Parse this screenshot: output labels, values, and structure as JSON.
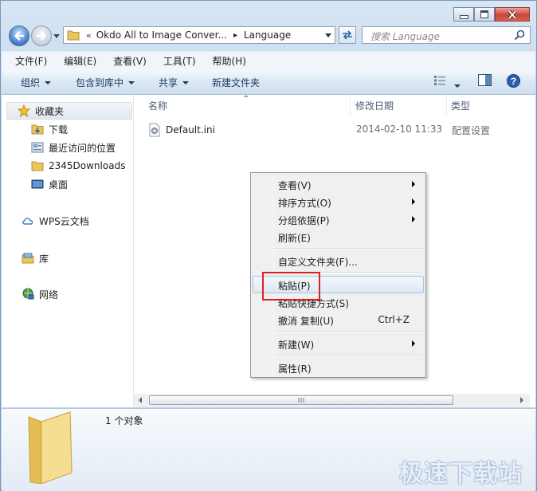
{
  "address": {
    "chevron": "«",
    "segments": [
      "Okdo All to Image Conver...",
      "Language"
    ],
    "separator": "▸"
  },
  "search": {
    "placeholder": "搜索 Language"
  },
  "menubar": [
    "文件(F)",
    "编辑(E)",
    "查看(V)",
    "工具(T)",
    "帮助(H)"
  ],
  "commandbar": {
    "organize": "组织",
    "include_library": "包含到库中",
    "share": "共享",
    "new_folder": "新建文件夹"
  },
  "navpane": {
    "favorites": "收藏夹",
    "items": [
      "下载",
      "最近访问的位置",
      "2345Downloads",
      "桌面"
    ],
    "wps": "WPS云文档",
    "library": "库",
    "network": "网络"
  },
  "columns": {
    "name": "名称",
    "modified": "修改日期",
    "type": "类型"
  },
  "files": [
    {
      "name": "Default.ini",
      "modified": "2014-02-10 11:33",
      "type": "配置设置",
      "icon": "ini-settings-icon"
    }
  ],
  "details": {
    "count": "1 个对象"
  },
  "context_menu": {
    "view": "查看(V)",
    "sort": "排序方式(O)",
    "group": "分组依据(P)",
    "refresh": "刷新(E)",
    "customize": "自定义文件夹(F)...",
    "paste": "粘贴(P)",
    "paste_shortcut": "粘贴快捷方式(S)",
    "undo": "撤消 复制(U)",
    "undo_accel": "Ctrl+Z",
    "new": "新建(W)",
    "properties": "属性(R)"
  },
  "watermark": "极速下载站",
  "colors": {
    "highlight": "#e02020",
    "window_frame": "#c7daee"
  }
}
